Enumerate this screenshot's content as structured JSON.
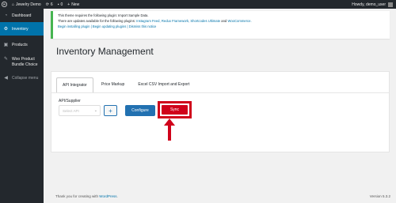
{
  "adminbar": {
    "site_name": "Jewelry Demo",
    "updates_count": "6",
    "comments_count": "0",
    "new_label": "New",
    "howdy": "Howdy, demo_user"
  },
  "sidebar": {
    "items": [
      {
        "label": "Dashboard",
        "icon": "dashboard-icon"
      },
      {
        "label": "Inventory",
        "icon": "gear-icon"
      },
      {
        "label": "Products",
        "icon": "products-icon"
      },
      {
        "label": "Woo Product Bundle Choice",
        "icon": "bundle-icon"
      },
      {
        "label": "Collapse menu",
        "icon": "collapse-icon"
      }
    ]
  },
  "notice": {
    "line1": "This theme requires the following plugin: Import Sample Data.",
    "line2_prefix": "There are updates available for the following plugins:",
    "line2_links": "Instagram Feed, Redux Framework, Shortcodes Ultimate",
    "line2_and": "and",
    "line2_last": "WooCommerce.",
    "line3": "Begin installing plugin | Begin updating plugins | Dismiss this notice"
  },
  "page_title": "Inventory Management",
  "tabs": [
    {
      "label": "API Integrator",
      "active": true
    },
    {
      "label": "Price Markup",
      "active": false
    },
    {
      "label": "Excel CSV Import and Export",
      "active": false
    }
  ],
  "form": {
    "field_label": "API/Supplier",
    "select_placeholder": "Select API",
    "plus_label": "+",
    "configure_label": "Configure",
    "sync_label": "Sync"
  },
  "footer": {
    "prefix": "Thank you for creating with",
    "link": "WordPress",
    "version": "Version 5.3.2"
  },
  "colors": {
    "admin_bar": "#23282d",
    "active_menu": "#0073aa",
    "primary_button": "#2271b1",
    "sync_highlight": "#d0021b",
    "notice_border": "#46b450"
  }
}
